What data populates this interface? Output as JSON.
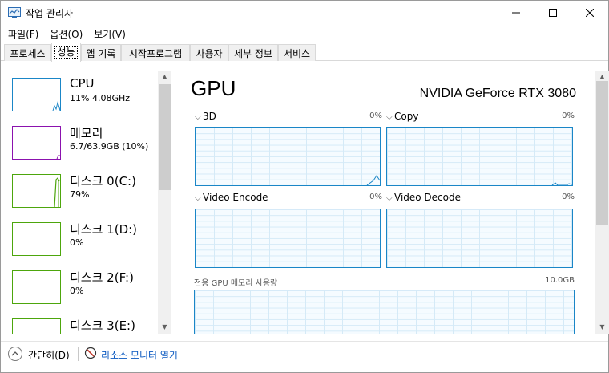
{
  "window": {
    "title": "작업 관리자"
  },
  "menu": [
    "파일(F)",
    "옵션(O)",
    "보기(V)"
  ],
  "tabs": [
    {
      "label": "프로세스",
      "active": false
    },
    {
      "label": "성능",
      "active": true
    },
    {
      "label": "앱 기록",
      "active": false
    },
    {
      "label": "시작프로그램",
      "active": false
    },
    {
      "label": "사용자",
      "active": false
    },
    {
      "label": "세부 정보",
      "active": false
    },
    {
      "label": "서비스",
      "active": false
    }
  ],
  "sidebar": {
    "items": [
      {
        "name": "CPU",
        "value": "11% 4.08GHz",
        "color": "#1a86c7",
        "selected": false
      },
      {
        "name": "메모리",
        "value": "6.7/63.9GB (10%)",
        "color": "#8b12ae",
        "selected": false
      },
      {
        "name": "디스크 0(C:)",
        "value": "79%",
        "color": "#4da60c",
        "selected": false
      },
      {
        "name": "디스크 1(D:)",
        "value": "0%",
        "color": "#4da60c",
        "selected": false
      },
      {
        "name": "디스크 2(F:)",
        "value": "0%",
        "color": "#4da60c",
        "selected": false
      },
      {
        "name": "디스크 3(E:)",
        "value": "",
        "color": "#4da60c",
        "selected": false
      }
    ]
  },
  "main": {
    "title": "GPU",
    "model": "NVIDIA GeForce RTX 3080",
    "graphs": [
      {
        "label": "3D",
        "percent": "0%"
      },
      {
        "label": "Copy",
        "percent": "0%"
      },
      {
        "label": "Video Encode",
        "percent": "0%"
      },
      {
        "label": "Video Decode",
        "percent": "0%"
      }
    ],
    "dedicated_memory": {
      "label": "전용 GPU 메모리 사용량",
      "max": "10.0GB"
    }
  },
  "footer": {
    "fewer_details": "간단히(D)",
    "resource_monitor": "리소스 모니터 열기"
  },
  "colors": {
    "gpu_accent": "#1a86c7",
    "cpu": "#1a86c7",
    "memory": "#8b12ae",
    "disk": "#4da60c",
    "link": "#0a59c1"
  }
}
